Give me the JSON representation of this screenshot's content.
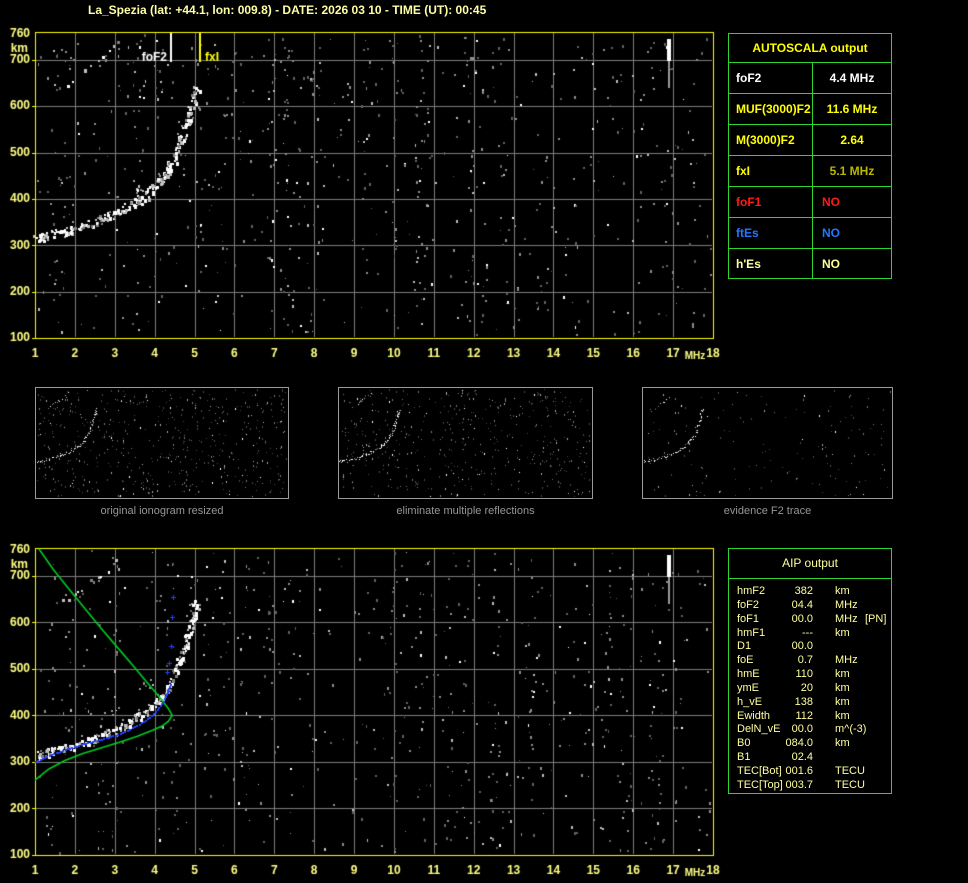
{
  "title": "La_Spezia (lat: +44.1, lon: 009.8) - DATE: 2026 03 10 - TIME (UT): 00:45",
  "colors": {
    "background": "#000000",
    "plot_border": "#ffff00",
    "grid": "#7d7d7d",
    "axis_label": "#ffff85",
    "title_text": "#ffffa6",
    "panel_border": "#2dd42d",
    "caption_gray": "#969696",
    "profile_green": "#00cc22",
    "restored_blue": "#2440ff",
    "trace_white": "#ffffff"
  },
  "axes": {
    "x_min": 1,
    "x_max": 18,
    "y_min": 100,
    "y_max": 760,
    "x_unit": "MHz",
    "y_unit": "km",
    "x_ticks": [
      1,
      2,
      3,
      4,
      5,
      6,
      7,
      8,
      9,
      10,
      11,
      12,
      13,
      14,
      15,
      16,
      17,
      18
    ],
    "y_ticks": [
      760,
      700,
      600,
      500,
      400,
      300,
      200,
      100
    ],
    "grid": true
  },
  "chart_data": {
    "type": "scatter",
    "f2_trace": [
      [
        1.0,
        316
      ],
      [
        1.2,
        320
      ],
      [
        1.4,
        324
      ],
      [
        1.6,
        328
      ],
      [
        1.8,
        332
      ],
      [
        2.0,
        337
      ],
      [
        2.2,
        343
      ],
      [
        2.4,
        349
      ],
      [
        2.6,
        356
      ],
      [
        2.8,
        362
      ],
      [
        3.0,
        370
      ],
      [
        3.2,
        379
      ],
      [
        3.4,
        389
      ],
      [
        3.6,
        400
      ],
      [
        3.8,
        413
      ],
      [
        4.0,
        428
      ],
      [
        4.15,
        444
      ],
      [
        4.3,
        462
      ],
      [
        4.45,
        483
      ],
      [
        4.55,
        505
      ],
      [
        4.65,
        528
      ],
      [
        4.75,
        553
      ],
      [
        4.85,
        580
      ],
      [
        4.93,
        606
      ],
      [
        5.0,
        628
      ],
      [
        5.06,
        646
      ]
    ],
    "second_hop_trace": [
      [
        1.5,
        628
      ],
      [
        1.8,
        648
      ],
      [
        2.1,
        668
      ],
      [
        2.4,
        688
      ],
      [
        2.7,
        708
      ],
      [
        2.95,
        728
      ],
      [
        3.1,
        745
      ]
    ],
    "profile_curve": [
      [
        1.0,
        261
      ],
      [
        1.35,
        285
      ],
      [
        1.75,
        303
      ],
      [
        2.2,
        318
      ],
      [
        2.65,
        330
      ],
      [
        3.1,
        342
      ],
      [
        3.55,
        355
      ],
      [
        3.95,
        368
      ],
      [
        4.2,
        378
      ],
      [
        4.35,
        388
      ],
      [
        4.44,
        400
      ],
      [
        4.35,
        414
      ],
      [
        4.3,
        420
      ],
      [
        4.1,
        442
      ],
      [
        3.8,
        472
      ],
      [
        3.45,
        508
      ],
      [
        3.05,
        548
      ],
      [
        2.65,
        588
      ],
      [
        2.25,
        630
      ],
      [
        1.85,
        672
      ],
      [
        1.45,
        715
      ],
      [
        1.1,
        758
      ]
    ],
    "restored_trace": [
      [
        1.0,
        303
      ],
      [
        1.4,
        317
      ],
      [
        1.8,
        329
      ],
      [
        2.2,
        340
      ],
      [
        2.6,
        349
      ],
      [
        3.0,
        359
      ],
      [
        3.3,
        369
      ],
      [
        3.6,
        382
      ],
      [
        3.85,
        397
      ],
      [
        4.05,
        414
      ],
      [
        4.2,
        432
      ],
      [
        4.3,
        450
      ],
      [
        4.38,
        468
      ]
    ],
    "isolated_blue_points": [
      [
        4.32,
        494
      ],
      [
        4.36,
        513
      ],
      [
        4.4,
        549
      ],
      [
        4.44,
        612
      ],
      [
        4.46,
        655
      ]
    ],
    "interference": {
      "freq": 16.87,
      "white_km": [
        745,
        698
      ],
      "gray_km": [
        698,
        640
      ]
    }
  },
  "top_plot": {
    "markers": [
      {
        "label": "foF2",
        "freq": 4.42,
        "color": "#ffffff",
        "label_side": "left"
      },
      {
        "label": "fxI",
        "freq": 5.14,
        "color": "#ffff00",
        "label_side": "right"
      }
    ],
    "noise": {
      "seed": 1337,
      "count": 520,
      "columns": 26
    }
  },
  "bottom_plot": {
    "noise": {
      "seed": 9001,
      "count": 520,
      "columns": 26
    }
  },
  "thumbnails": [
    {
      "caption": "original ionogram resized",
      "seed": 11,
      "noise_count": 540
    },
    {
      "caption": "eliminate multiple reflections",
      "seed": 22,
      "noise_count": 470
    },
    {
      "caption": "evidence F2 trace",
      "seed": 33,
      "noise_count": 150
    }
  ],
  "autoscala": {
    "header": "AUTOSCALA output",
    "rows": [
      {
        "label": "foF2",
        "value": "4.4 MHz",
        "label_color": "#ffffff",
        "value_color": "#ffffff"
      },
      {
        "label": "MUF(3000)F2",
        "value": "11.6 MHz",
        "label_color": "#ffff00",
        "value_color": "#ffff00"
      },
      {
        "label": "M(3000)F2",
        "value": "2.64",
        "label_color": "#ffff00",
        "value_color": "#ffff00"
      },
      {
        "label": "fxI",
        "value": "5.1 MHz",
        "label_color": "#ffff00",
        "value_color": "#b8b800"
      },
      {
        "label": "foF1",
        "value": "NO",
        "label_color": "#ff1a1a",
        "value_color": "#ff1a1a"
      },
      {
        "label": "ftEs",
        "value": "NO",
        "label_color": "#2277ff",
        "value_color": "#2277ff"
      },
      {
        "label": "h'Es",
        "value": "NO",
        "label_color": "#ffff9b",
        "value_color": "#ffff9b"
      }
    ]
  },
  "aip": {
    "header": "AIP output",
    "rows": [
      {
        "param": "hmF2",
        "value": "382",
        "unit": "km",
        "note": ""
      },
      {
        "param": "foF2",
        "value": "04.4",
        "unit": "MHz",
        "note": ""
      },
      {
        "param": "foF1",
        "value": "00.0",
        "unit": "MHz",
        "note": "[PN]"
      },
      {
        "param": "hmF1",
        "value": "---",
        "unit": "km",
        "note": ""
      },
      {
        "param": "D1",
        "value": "00.0",
        "unit": "",
        "note": ""
      },
      {
        "param": "foE",
        "value": "0.7",
        "unit": "MHz",
        "note": ""
      },
      {
        "param": "hmE",
        "value": "110",
        "unit": "km",
        "note": ""
      },
      {
        "param": "ymE",
        "value": "20",
        "unit": "km",
        "note": ""
      },
      {
        "param": "h_vE",
        "value": "138",
        "unit": "km",
        "note": ""
      },
      {
        "param": "Ewidth",
        "value": "112",
        "unit": "km",
        "note": ""
      },
      {
        "param": "DelN_vE",
        "value": "00.0",
        "unit": "m^(-3)",
        "note": ""
      },
      {
        "param": "B0",
        "value": "084.0",
        "unit": "km",
        "note": ""
      },
      {
        "param": "B1",
        "value": "02.4",
        "unit": "",
        "note": ""
      },
      {
        "param": "TEC[Bot]",
        "value": "001.6",
        "unit": "TECU",
        "note": ""
      },
      {
        "param": "TEC[Top]",
        "value": "003.7",
        "unit": "TECU",
        "note": ""
      }
    ]
  }
}
